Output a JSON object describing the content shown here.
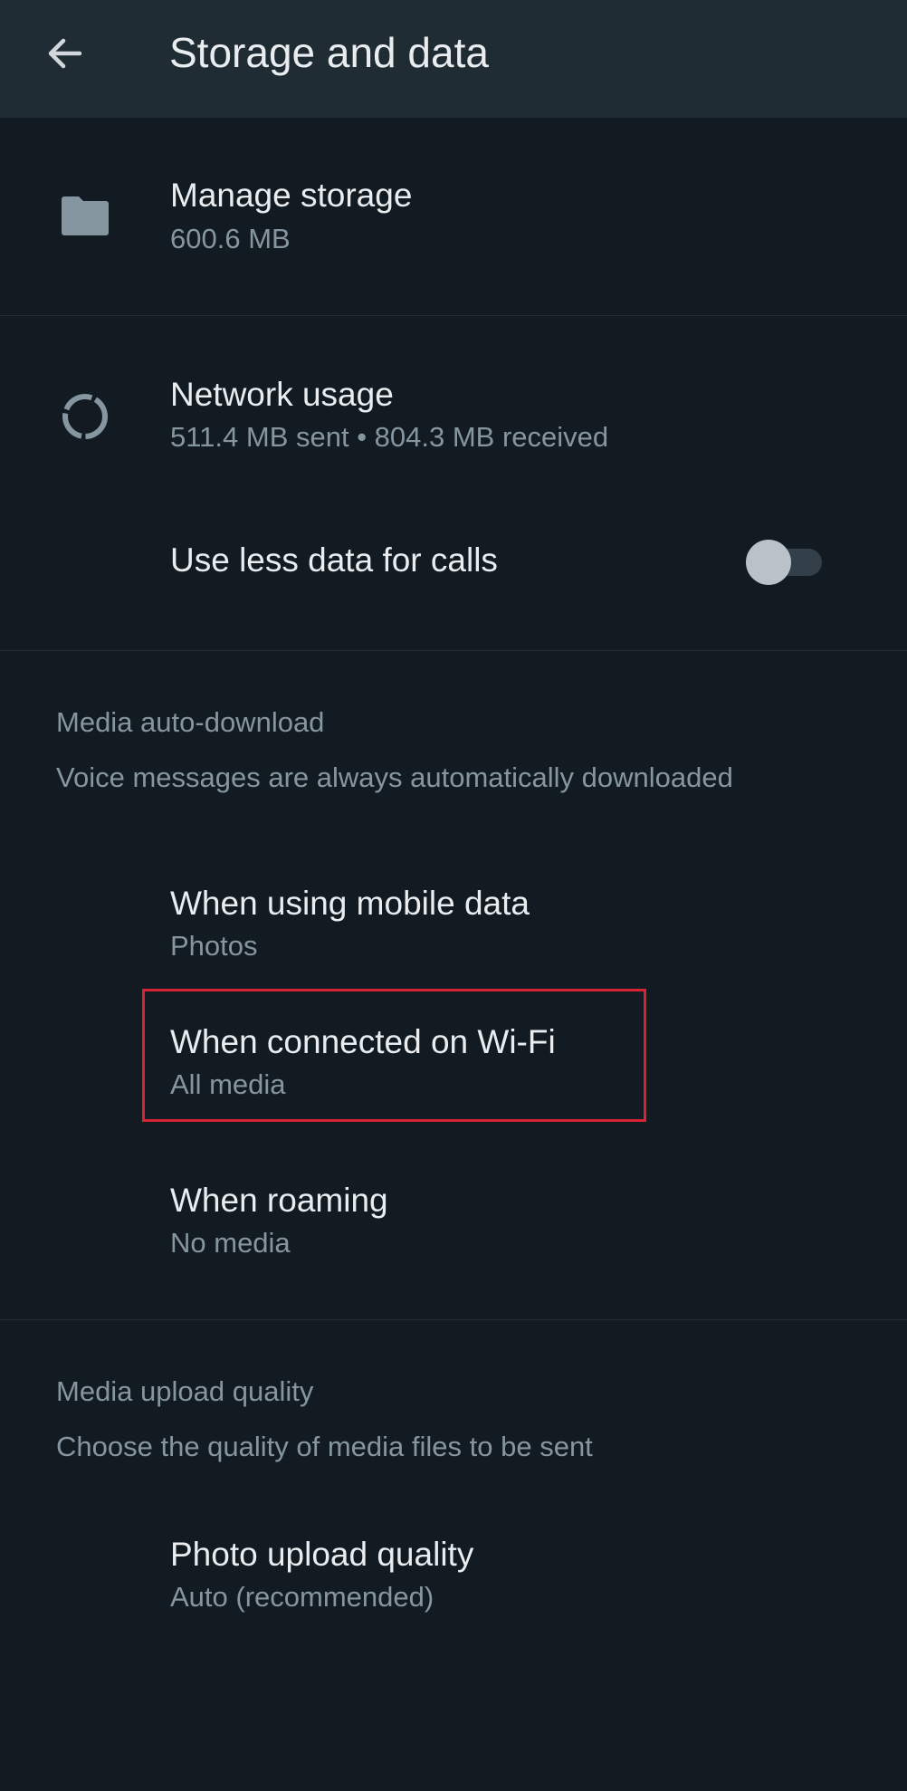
{
  "app_bar": {
    "title": "Storage and data",
    "back_icon": "arrow-left-icon"
  },
  "manage_storage": {
    "icon": "folder-icon",
    "title": "Manage storage",
    "subtitle": "600.6 MB"
  },
  "network_usage": {
    "icon": "circular-progress-icon",
    "title": "Network usage",
    "subtitle": "511.4 MB sent • 804.3 MB received"
  },
  "less_data_calls": {
    "title": "Use less data for calls",
    "enabled": false
  },
  "media_auto_download": {
    "header": "Media auto-download",
    "description": "Voice messages are always automatically downloaded",
    "items": [
      {
        "title": "When using mobile data",
        "subtitle": "Photos"
      },
      {
        "title": "When connected on Wi-Fi",
        "subtitle": "All media"
      },
      {
        "title": "When roaming",
        "subtitle": "No media"
      }
    ]
  },
  "media_upload_quality": {
    "header": "Media upload quality",
    "description": "Choose the quality of media files to be sent",
    "items": [
      {
        "title": "Photo upload quality",
        "subtitle": "Auto (recommended)"
      }
    ]
  },
  "colors": {
    "background": "#121B22",
    "app_bar": "#202C33",
    "primary_text": "#E9EDEF",
    "secondary_text": "#8696A0",
    "highlight": "#D92234"
  }
}
